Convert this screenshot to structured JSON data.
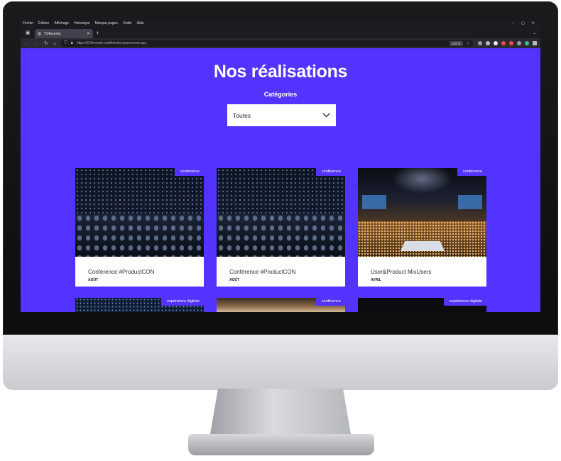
{
  "browser": {
    "menu": [
      "Fichier",
      "Édition",
      "Affichage",
      "Historique",
      "Marque-pages",
      "Outils",
      "Aide"
    ],
    "tab_title": "T24events",
    "url": "https://t24events-matthieubonjourcrewai.app",
    "zoom": "120 %"
  },
  "page": {
    "title": "Nos réalisations",
    "category_label": "Catégories",
    "select_value": "Toutes"
  },
  "cards": [
    {
      "badge": "conférence",
      "title": "Conférence #ProductCON",
      "date": "AOÛT"
    },
    {
      "badge": "conférence",
      "title": "Conférence #ProductCON",
      "date": "AOÛT"
    },
    {
      "badge": "conférence",
      "title": "User&Product MixUsers",
      "date": "AVRIL"
    }
  ],
  "partial_cards": [
    {
      "badge": "expérience digitale"
    },
    {
      "badge": "conférence"
    },
    {
      "badge": "expérience digitale"
    }
  ]
}
